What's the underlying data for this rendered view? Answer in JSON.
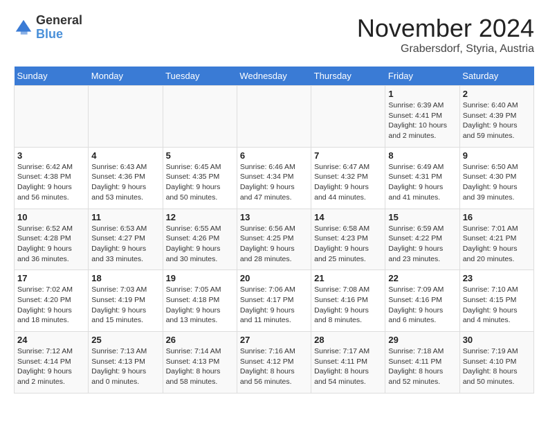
{
  "header": {
    "logo": {
      "general": "General",
      "blue": "Blue"
    },
    "title": "November 2024",
    "location": "Grabersdorf, Styria, Austria"
  },
  "weekdays": [
    "Sunday",
    "Monday",
    "Tuesday",
    "Wednesday",
    "Thursday",
    "Friday",
    "Saturday"
  ],
  "weeks": [
    [
      {
        "day": "",
        "sunrise": "",
        "sunset": "",
        "daylight": ""
      },
      {
        "day": "",
        "sunrise": "",
        "sunset": "",
        "daylight": ""
      },
      {
        "day": "",
        "sunrise": "",
        "sunset": "",
        "daylight": ""
      },
      {
        "day": "",
        "sunrise": "",
        "sunset": "",
        "daylight": ""
      },
      {
        "day": "",
        "sunrise": "",
        "sunset": "",
        "daylight": ""
      },
      {
        "day": "1",
        "sunrise": "Sunrise: 6:39 AM",
        "sunset": "Sunset: 4:41 PM",
        "daylight": "Daylight: 10 hours and 2 minutes."
      },
      {
        "day": "2",
        "sunrise": "Sunrise: 6:40 AM",
        "sunset": "Sunset: 4:39 PM",
        "daylight": "Daylight: 9 hours and 59 minutes."
      }
    ],
    [
      {
        "day": "3",
        "sunrise": "Sunrise: 6:42 AM",
        "sunset": "Sunset: 4:38 PM",
        "daylight": "Daylight: 9 hours and 56 minutes."
      },
      {
        "day": "4",
        "sunrise": "Sunrise: 6:43 AM",
        "sunset": "Sunset: 4:36 PM",
        "daylight": "Daylight: 9 hours and 53 minutes."
      },
      {
        "day": "5",
        "sunrise": "Sunrise: 6:45 AM",
        "sunset": "Sunset: 4:35 PM",
        "daylight": "Daylight: 9 hours and 50 minutes."
      },
      {
        "day": "6",
        "sunrise": "Sunrise: 6:46 AM",
        "sunset": "Sunset: 4:34 PM",
        "daylight": "Daylight: 9 hours and 47 minutes."
      },
      {
        "day": "7",
        "sunrise": "Sunrise: 6:47 AM",
        "sunset": "Sunset: 4:32 PM",
        "daylight": "Daylight: 9 hours and 44 minutes."
      },
      {
        "day": "8",
        "sunrise": "Sunrise: 6:49 AM",
        "sunset": "Sunset: 4:31 PM",
        "daylight": "Daylight: 9 hours and 41 minutes."
      },
      {
        "day": "9",
        "sunrise": "Sunrise: 6:50 AM",
        "sunset": "Sunset: 4:30 PM",
        "daylight": "Daylight: 9 hours and 39 minutes."
      }
    ],
    [
      {
        "day": "10",
        "sunrise": "Sunrise: 6:52 AM",
        "sunset": "Sunset: 4:28 PM",
        "daylight": "Daylight: 9 hours and 36 minutes."
      },
      {
        "day": "11",
        "sunrise": "Sunrise: 6:53 AM",
        "sunset": "Sunset: 4:27 PM",
        "daylight": "Daylight: 9 hours and 33 minutes."
      },
      {
        "day": "12",
        "sunrise": "Sunrise: 6:55 AM",
        "sunset": "Sunset: 4:26 PM",
        "daylight": "Daylight: 9 hours and 30 minutes."
      },
      {
        "day": "13",
        "sunrise": "Sunrise: 6:56 AM",
        "sunset": "Sunset: 4:25 PM",
        "daylight": "Daylight: 9 hours and 28 minutes."
      },
      {
        "day": "14",
        "sunrise": "Sunrise: 6:58 AM",
        "sunset": "Sunset: 4:23 PM",
        "daylight": "Daylight: 9 hours and 25 minutes."
      },
      {
        "day": "15",
        "sunrise": "Sunrise: 6:59 AM",
        "sunset": "Sunset: 4:22 PM",
        "daylight": "Daylight: 9 hours and 23 minutes."
      },
      {
        "day": "16",
        "sunrise": "Sunrise: 7:01 AM",
        "sunset": "Sunset: 4:21 PM",
        "daylight": "Daylight: 9 hours and 20 minutes."
      }
    ],
    [
      {
        "day": "17",
        "sunrise": "Sunrise: 7:02 AM",
        "sunset": "Sunset: 4:20 PM",
        "daylight": "Daylight: 9 hours and 18 minutes."
      },
      {
        "day": "18",
        "sunrise": "Sunrise: 7:03 AM",
        "sunset": "Sunset: 4:19 PM",
        "daylight": "Daylight: 9 hours and 15 minutes."
      },
      {
        "day": "19",
        "sunrise": "Sunrise: 7:05 AM",
        "sunset": "Sunset: 4:18 PM",
        "daylight": "Daylight: 9 hours and 13 minutes."
      },
      {
        "day": "20",
        "sunrise": "Sunrise: 7:06 AM",
        "sunset": "Sunset: 4:17 PM",
        "daylight": "Daylight: 9 hours and 11 minutes."
      },
      {
        "day": "21",
        "sunrise": "Sunrise: 7:08 AM",
        "sunset": "Sunset: 4:16 PM",
        "daylight": "Daylight: 9 hours and 8 minutes."
      },
      {
        "day": "22",
        "sunrise": "Sunrise: 7:09 AM",
        "sunset": "Sunset: 4:16 PM",
        "daylight": "Daylight: 9 hours and 6 minutes."
      },
      {
        "day": "23",
        "sunrise": "Sunrise: 7:10 AM",
        "sunset": "Sunset: 4:15 PM",
        "daylight": "Daylight: 9 hours and 4 minutes."
      }
    ],
    [
      {
        "day": "24",
        "sunrise": "Sunrise: 7:12 AM",
        "sunset": "Sunset: 4:14 PM",
        "daylight": "Daylight: 9 hours and 2 minutes."
      },
      {
        "day": "25",
        "sunrise": "Sunrise: 7:13 AM",
        "sunset": "Sunset: 4:13 PM",
        "daylight": "Daylight: 9 hours and 0 minutes."
      },
      {
        "day": "26",
        "sunrise": "Sunrise: 7:14 AM",
        "sunset": "Sunset: 4:13 PM",
        "daylight": "Daylight: 8 hours and 58 minutes."
      },
      {
        "day": "27",
        "sunrise": "Sunrise: 7:16 AM",
        "sunset": "Sunset: 4:12 PM",
        "daylight": "Daylight: 8 hours and 56 minutes."
      },
      {
        "day": "28",
        "sunrise": "Sunrise: 7:17 AM",
        "sunset": "Sunset: 4:11 PM",
        "daylight": "Daylight: 8 hours and 54 minutes."
      },
      {
        "day": "29",
        "sunrise": "Sunrise: 7:18 AM",
        "sunset": "Sunset: 4:11 PM",
        "daylight": "Daylight: 8 hours and 52 minutes."
      },
      {
        "day": "30",
        "sunrise": "Sunrise: 7:19 AM",
        "sunset": "Sunset: 4:10 PM",
        "daylight": "Daylight: 8 hours and 50 minutes."
      }
    ]
  ]
}
